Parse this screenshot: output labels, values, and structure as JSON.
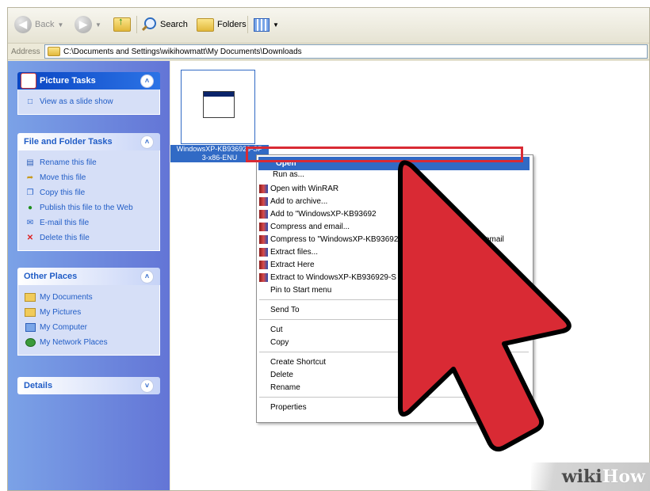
{
  "toolbar": {
    "back_label": "Back",
    "search_label": "Search",
    "folders_label": "Folders"
  },
  "address": {
    "label": "Address",
    "path": "C:\\Documents and Settings\\wikihowmatt\\My Documents\\Downloads"
  },
  "sidebar": {
    "picture_tasks": {
      "title": "Picture Tasks",
      "items": [
        "View as a slide show"
      ]
    },
    "file_folder_tasks": {
      "title": "File and Folder Tasks",
      "items": [
        "Rename this file",
        "Move this file",
        "Copy this file",
        "Publish this file to the Web",
        "E-mail this file",
        "Delete this file"
      ]
    },
    "other_places": {
      "title": "Other Places",
      "items": [
        "My Documents",
        "My Pictures",
        "My Computer",
        "My Network Places"
      ]
    },
    "details": {
      "title": "Details"
    }
  },
  "file": {
    "name_line1": "WindowsXP-KB936929-SP",
    "name_line2": "3-x86-ENU"
  },
  "context_menu": {
    "open": "Open",
    "run_as": "Run as...",
    "winrar": [
      "Open with WinRAR",
      "Add to archive...",
      "Add to \"WindowsXP-KB93692",
      "Compress and email...",
      "Compress to \"WindowsXP-KB93692",
      "Extract files...",
      "Extract Here",
      "Extract to WindowsXP-KB936929-S"
    ],
    "compress_to_suffix": "email",
    "pin": "Pin to Start menu",
    "send_to": "Send To",
    "cut": "Cut",
    "copy": "Copy",
    "create_shortcut": "Create Shortcut",
    "delete": "Delete",
    "rename": "Rename",
    "properties": "Properties"
  },
  "watermark": {
    "part1": "wiki",
    "part2": "How"
  },
  "colors": {
    "highlight": "#316ac5",
    "annotation_red": "#d92a34"
  }
}
